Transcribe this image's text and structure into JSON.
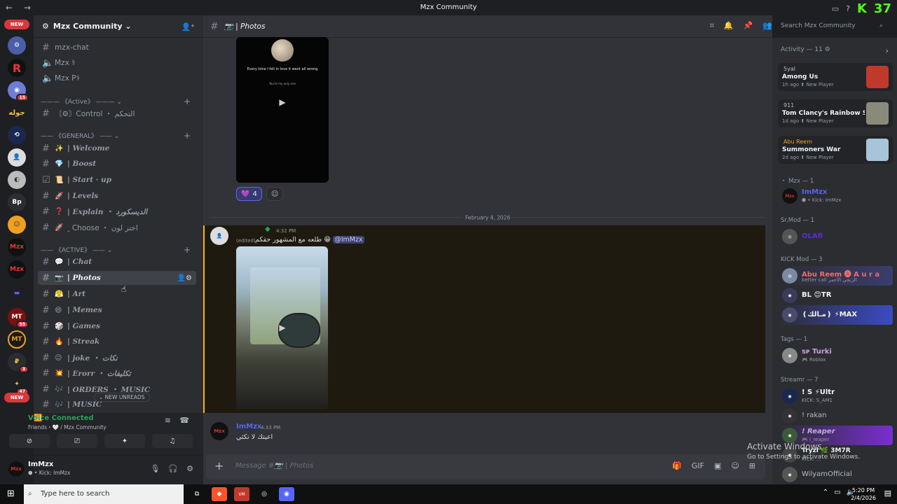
{
  "window": {
    "title": "Mzx Community",
    "nav_icons": "← →",
    "kick_count": "37"
  },
  "guilds": {
    "new_label_top": "NEW",
    "new_label_bottom": "NEW",
    "badges": [
      "15",
      "55",
      "3",
      "47"
    ]
  },
  "server": {
    "name": "Mzx Community ⌄"
  },
  "channels": [
    {
      "name": "mzx-chat",
      "icon": "#",
      "emoji": ""
    },
    {
      "name": "Mzx ⚕",
      "icon": "🔈",
      "emoji": ""
    },
    {
      "name": "Mzx P⚕",
      "icon": "🔈",
      "emoji": ""
    }
  ],
  "categories": {
    "active1": "——— 《Active》 ——— ⌄",
    "general": "—— 《GENERAL》 —— ⌄",
    "active2": "—— 《ACTIVE》 —— ⌄"
  },
  "channel_list": [
    {
      "label": "〘⚙〙Control ・ التحكم",
      "emoji": "",
      "italic": false
    },
    {
      "label": "| Welcome",
      "emoji": "✨",
      "italic": true
    },
    {
      "label": "| Boost",
      "emoji": "💎",
      "italic": true
    },
    {
      "label": "| Start · up",
      "emoji": "📜",
      "italic": true
    },
    {
      "label": "| Levels",
      "emoji": "🚀",
      "italic": true
    },
    {
      "label": "| Explain ・ الديسكورد",
      "emoji": "❓",
      "italic": true
    },
    {
      "label": "ꞈ Choose ・ اختر لون",
      "emoji": "🚀",
      "italic": false
    },
    {
      "label": "| Chat",
      "emoji": "💬",
      "italic": true
    },
    {
      "label": "| Photos",
      "emoji": "📷",
      "italic": true
    },
    {
      "label": "| Art",
      "emoji": "😤",
      "italic": true
    },
    {
      "label": "| Memes",
      "emoji": "😄",
      "italic": true
    },
    {
      "label": "| Games",
      "emoji": "🎲",
      "italic": true
    },
    {
      "label": "| Streak",
      "emoji": "🔥",
      "italic": true
    },
    {
      "label": "| joke ・ نكات",
      "emoji": "😉",
      "italic": true
    },
    {
      "label": "| Erorr ・ تكليفات",
      "emoji": "💥",
      "italic": true
    },
    {
      "label": "| ORDERS ・ MUSIC",
      "emoji": "🎶",
      "italic": true
    },
    {
      "label": "| MUSIC",
      "emoji": "🎶",
      "italic": true
    }
  ],
  "new_unreads": "⌄ NEW UNREADS",
  "voice": {
    "status": "Voice Connected",
    "sub": "Friends・🤍 / Mzx Community"
  },
  "user": {
    "name": "ImMzx",
    "status": "⬢ • Kick: ImMzx"
  },
  "channel_header": {
    "name": "📷 | Photos"
  },
  "search": {
    "placeholder": "Search Mzx Community"
  },
  "video_card": {
    "text": "Every time I fell in love it went all wrong",
    "sub": "You're my only one"
  },
  "reactions": [
    {
      "emoji": "💜",
      "count": "4"
    }
  ],
  "date_divider": "February 4, 2026",
  "messages": [
    {
      "name": "",
      "time": "4:32 PM",
      "edited": "(edited)",
      "text": "طلعه مع المشهور حقكم 😁",
      "mention": "@ImMzx"
    },
    {
      "name": "ImMzx",
      "time": "4:33 PM",
      "text": "اعيتك لا تكثي"
    }
  ],
  "composer": {
    "placeholder": "Message #📷 | Photos"
  },
  "activity": {
    "header": "Activity — 11 ⚙",
    "cards": [
      {
        "user": "5yal",
        "game": "Among Us",
        "meta": "1h ago  ⬆ New Player"
      },
      {
        "user": "911",
        "game": "Tom Clancy's Rainbow Six ...",
        "meta": "1d ago  ⬆ New Player"
      },
      {
        "user": "Abu Reem",
        "game": "Summoners War",
        "meta": "2d ago  ⬆ New Player"
      }
    ]
  },
  "member_groups": [
    {
      "role": "・ Mzx — 1"
    },
    {
      "role": "Sr.Mod — 1"
    },
    {
      "role": "KICK Mod — 3"
    },
    {
      "role": "Tags — 1"
    },
    {
      "role": "Streamr — 7"
    }
  ],
  "members": [
    {
      "name": "ImMzx",
      "sub": "⬢ • Kick: ImMzx",
      "color": "#5865f2"
    },
    {
      "name": "OLAfi",
      "sub": "",
      "color": "#5b2bd6"
    },
    {
      "name": "Abu Reem 🅐 A u r a",
      "sub": "better call الزنجي الأحمر",
      "color": "#f06b6b"
    },
    {
      "name": "BL 😊TR",
      "sub": "",
      "color": "#f2f3f5"
    },
    {
      "name": "❪مـالك❫ ⚡MAX",
      "sub": "",
      "color": "#f2f3f5"
    },
    {
      "name": "ꜱᴘ Turki",
      "sub": "🎮 Roblox",
      "color": "#c9a0dc"
    },
    {
      "name": "! S ⚡Ultr",
      "sub": "KICK: S_AM1",
      "color": "#f2f3f5"
    },
    {
      "name": "! rakan",
      "sub": "",
      "color": "#b5bac1"
    },
    {
      "name": "! Reaper",
      "sub": "🎮 i_reaper",
      "color": "#b5b0e0"
    },
    {
      "name": "Tryzl 🌿 3M7R",
      "sub": "KICK: ...",
      "color": "#f2f3f5"
    },
    {
      "name": "WilyamOfficial",
      "sub": "",
      "color": "#b5bac1"
    }
  ],
  "watermark": {
    "line1": "Activate Windows",
    "line2": "Go to Settings to activate Windows."
  },
  "taskbar": {
    "search": "Type here to search",
    "time": "5:20 PM",
    "date": "2/4/2026"
  }
}
